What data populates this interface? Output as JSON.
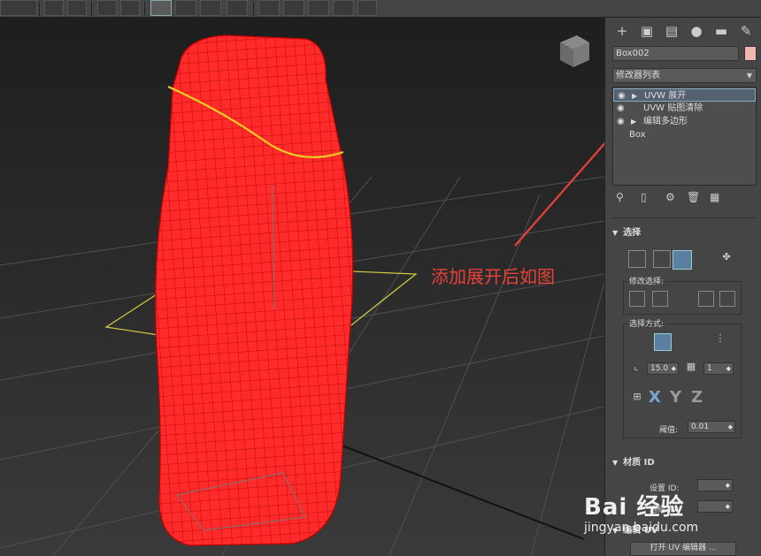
{
  "viewport": {
    "annotation": "添加展开后如图"
  },
  "watermark": {
    "logo_text": "Bai 经验",
    "url": "jingyan.baidu.com"
  },
  "panel": {
    "tabs": [
      "+",
      "modify-icon",
      "hierarchy-icon",
      "motion-icon",
      "display-icon",
      "utilities-icon"
    ],
    "object_name": "Box002",
    "object_color": "#f0b8b0",
    "modifier_list_label": "修改器列表",
    "stack": [
      {
        "label": "UVW 展开",
        "selected": true
      },
      {
        "label": "UVW 贴图清除",
        "selected": false
      },
      {
        "label": "编辑多边形",
        "selected": false
      },
      {
        "label": "Box",
        "selected": false
      }
    ],
    "selection_rollout": {
      "title": "选择",
      "modify_group_label": "修改选择:",
      "method_group_label": "选择方式:",
      "angle_value": "15.0",
      "count_value": "1",
      "threshold_label": "阈值:",
      "threshold_value": "0.01",
      "axis_labels": [
        "X",
        "Y",
        "Z"
      ]
    },
    "material_rollout": {
      "title": "材质 ID",
      "set_id_label": "设置 ID:",
      "select_id_label": "选择 ID:"
    },
    "edit_rollout": {
      "title": "编辑 UV",
      "open_editor_label": "打开 UV 编辑器 ..."
    }
  },
  "colors": {
    "mesh": "#ff2a2a",
    "mesh_lines": "#a00000",
    "annotation": "#e8413a",
    "gizmo": "#d8d040"
  }
}
